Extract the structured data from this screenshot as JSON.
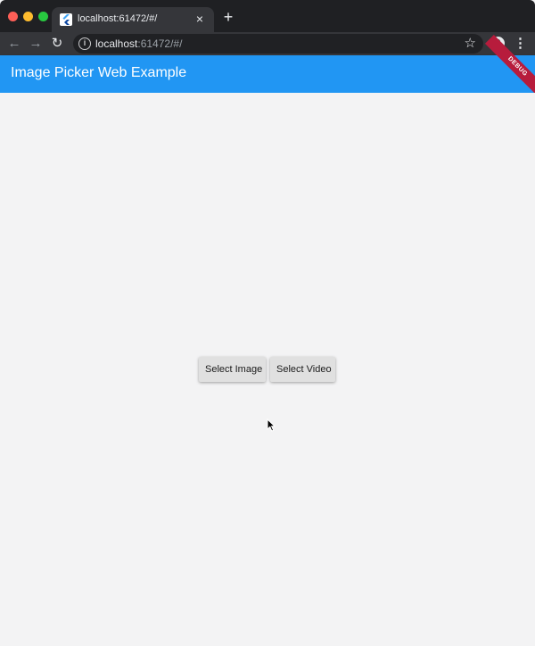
{
  "browser": {
    "tab_title": "localhost:61472/#/",
    "tab_close": "×",
    "new_tab": "+",
    "url_host": "localhost",
    "url_rest": ":61472/#/",
    "back_icon": "←",
    "forward_icon": "→",
    "reload_icon": "↻",
    "info_icon": "i",
    "star_icon": "☆",
    "menu_icon": "⋮"
  },
  "app": {
    "title": "Image Picker Web Example",
    "debug_banner": "DEBUG",
    "primary_color": "#2196f3"
  },
  "actions": {
    "select_image": "Select Image",
    "select_video": "Select Video"
  }
}
